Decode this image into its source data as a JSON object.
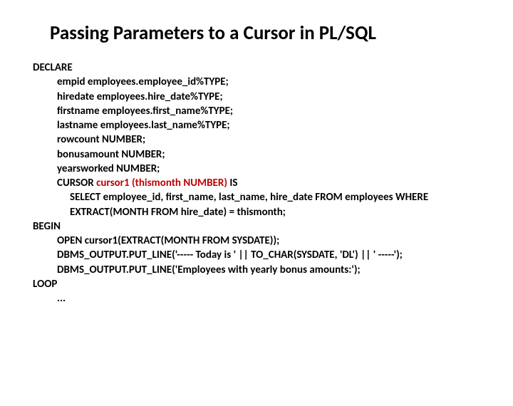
{
  "title": "Passing Parameters to a Cursor in PL/SQL",
  "code": {
    "l1": "DECLARE",
    "l2": "empid employees.employee_id%TYPE;",
    "l3": "hiredate employees.hire_date%TYPE;",
    "l4": "firstname employees.first_name%TYPE;",
    "l5": "lastname employees.last_name%TYPE;",
    "l6": "rowcount NUMBER;",
    "l7": "bonusamount NUMBER;",
    "l8": "yearsworked NUMBER;",
    "l9a": "CURSOR ",
    "l9b": "cursor1 (thismonth NUMBER) ",
    "l9c": "IS",
    "l10": "SELECT employee_id, first_name, last_name, hire_date FROM employees WHERE",
    "l11": "EXTRACT(MONTH FROM hire_date) = thismonth;",
    "l12": "BEGIN",
    "l13": "OPEN cursor1(EXTRACT(MONTH FROM SYSDATE));",
    "l14": "DBMS_OUTPUT.PUT_LINE('----- Today is ' || TO_CHAR(SYSDATE, 'DL') || ' -----');",
    "l15": "DBMS_OUTPUT.PUT_LINE('Employees with yearly bonus amounts:');",
    "l16": "LOOP",
    "l17": "..."
  }
}
